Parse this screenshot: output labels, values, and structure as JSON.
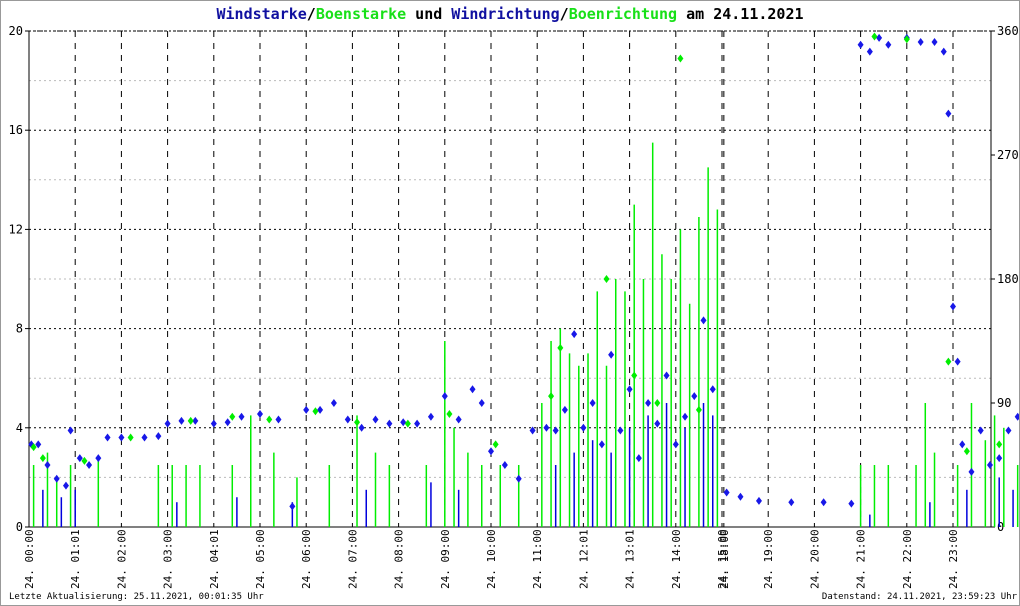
{
  "chart_data": {
    "type": "scatter",
    "title_parts": {
      "a": "Windstarke",
      "sep1": "/",
      "b": "Boenstarke",
      "mid": " und ",
      "c": "Windrichtung",
      "sep2": "/",
      "d": "Boenrichtung",
      "end": " am 24.11.2021"
    },
    "left_axis": {
      "ylim": [
        0,
        20
      ],
      "ticks": [
        0,
        4,
        8,
        12,
        16,
        20
      ]
    },
    "right_axis": {
      "ylim": [
        0,
        360
      ],
      "ticks": [
        0,
        90,
        180,
        270,
        360
      ]
    },
    "x_ticks": [
      {
        "u": 0,
        "label": "24. 00:00"
      },
      {
        "u": 1,
        "label": "24. 01:01"
      },
      {
        "u": 2,
        "label": "24. 02:00"
      },
      {
        "u": 3,
        "label": "24. 03:00"
      },
      {
        "u": 4,
        "label": "24. 04:01"
      },
      {
        "u": 5,
        "label": "24. 05:00"
      },
      {
        "u": 6,
        "label": "24. 06:00"
      },
      {
        "u": 7,
        "label": "24. 07:00"
      },
      {
        "u": 8,
        "label": "24. 08:00"
      },
      {
        "u": 9,
        "label": "24. 09:00"
      },
      {
        "u": 10,
        "label": "24. 10:00"
      },
      {
        "u": 11,
        "label": "24. 11:00"
      },
      {
        "u": 12,
        "label": "24. 12:01"
      },
      {
        "u": 13,
        "label": "24. 13:01"
      },
      {
        "u": 14,
        "label": "24. 14:00"
      },
      {
        "u": 15,
        "label": "24. 15:00"
      },
      {
        "u": 15.04,
        "label": "24. 18:00"
      },
      {
        "u": 16,
        "label": "24. 19:00"
      },
      {
        "u": 17,
        "label": "24. 20:00"
      },
      {
        "u": 18,
        "label": "24. 21:00"
      },
      {
        "u": 19,
        "label": "24. 22:00"
      },
      {
        "u": 20,
        "label": "24. 23:00"
      }
    ],
    "series": [
      {
        "name": "Boenstarke",
        "color": "#00ee00",
        "kind": "bars",
        "points": [
          [
            0.1,
            2.5
          ],
          [
            0.4,
            3
          ],
          [
            0.6,
            2
          ],
          [
            0.9,
            2.5
          ],
          [
            1.5,
            2.8
          ],
          [
            2.8,
            2.5
          ],
          [
            3.1,
            2.5
          ],
          [
            3.4,
            2.5
          ],
          [
            3.7,
            2.5
          ],
          [
            4.4,
            2.5
          ],
          [
            4.8,
            4.5
          ],
          [
            5.3,
            3
          ],
          [
            5.8,
            2
          ],
          [
            6.5,
            2.5
          ],
          [
            7.1,
            4.5
          ],
          [
            7.5,
            3
          ],
          [
            7.8,
            2.5
          ],
          [
            8.6,
            2.5
          ],
          [
            9,
            7.5
          ],
          [
            9.2,
            4
          ],
          [
            9.5,
            3
          ],
          [
            9.8,
            2.5
          ],
          [
            10.2,
            2.5
          ],
          [
            10.6,
            2.5
          ],
          [
            11.1,
            5
          ],
          [
            11.3,
            7.5
          ],
          [
            11.5,
            8
          ],
          [
            11.7,
            7
          ],
          [
            11.9,
            6.5
          ],
          [
            12.1,
            7
          ],
          [
            12.3,
            9.5
          ],
          [
            12.5,
            6.5
          ],
          [
            12.7,
            10
          ],
          [
            12.9,
            9.5
          ],
          [
            13.1,
            13
          ],
          [
            13.3,
            10
          ],
          [
            13.5,
            15.5
          ],
          [
            13.7,
            11
          ],
          [
            13.9,
            10
          ],
          [
            14.1,
            12
          ],
          [
            14.3,
            9
          ],
          [
            14.5,
            12.5
          ],
          [
            14.7,
            14.5
          ],
          [
            14.9,
            12.8
          ],
          [
            18,
            2.5
          ],
          [
            18.3,
            2.5
          ],
          [
            18.6,
            2.5
          ],
          [
            19.2,
            2.5
          ],
          [
            19.4,
            5
          ],
          [
            19.6,
            3
          ],
          [
            20.1,
            2.5
          ],
          [
            20.4,
            5
          ],
          [
            20.7,
            3.5
          ],
          [
            20.9,
            4.5
          ],
          [
            21.1,
            4
          ],
          [
            21.4,
            2.5
          ]
        ]
      },
      {
        "name": "Windstarke",
        "color": "#0000dd",
        "kind": "bars",
        "points": [
          [
            0.3,
            1.5
          ],
          [
            0.7,
            1.2
          ],
          [
            1,
            1.5
          ],
          [
            3.2,
            1
          ],
          [
            4.5,
            1.2
          ],
          [
            5.7,
            1
          ],
          [
            7.3,
            1.5
          ],
          [
            8.7,
            1.8
          ],
          [
            9.3,
            1.5
          ],
          [
            11.4,
            2.5
          ],
          [
            11.8,
            3
          ],
          [
            12.2,
            3.5
          ],
          [
            12.6,
            3
          ],
          [
            13,
            4
          ],
          [
            13.4,
            4.5
          ],
          [
            13.8,
            5
          ],
          [
            14.2,
            4
          ],
          [
            14.6,
            5
          ],
          [
            14.8,
            4.5
          ],
          [
            18.2,
            0.5
          ],
          [
            19.5,
            1
          ],
          [
            20.3,
            1.5
          ],
          [
            21,
            2
          ],
          [
            21.3,
            1.5
          ]
        ]
      },
      {
        "name": "Windrichtung",
        "color": "#1818e8",
        "kind": "diamonds",
        "points": [
          [
            0.05,
            60
          ],
          [
            0.2,
            60
          ],
          [
            0.4,
            45
          ],
          [
            0.6,
            35
          ],
          [
            0.8,
            30
          ],
          [
            0.9,
            70
          ],
          [
            1.1,
            50
          ],
          [
            1.3,
            45
          ],
          [
            1.5,
            50
          ],
          [
            1.7,
            65
          ],
          [
            2,
            65
          ],
          [
            2.5,
            65
          ],
          [
            2.8,
            66
          ],
          [
            3,
            75
          ],
          [
            3.3,
            77
          ],
          [
            3.6,
            77
          ],
          [
            4,
            75
          ],
          [
            4.3,
            76
          ],
          [
            4.6,
            80
          ],
          [
            5,
            82
          ],
          [
            5.4,
            78
          ],
          [
            5.7,
            15
          ],
          [
            6,
            85
          ],
          [
            6.3,
            85
          ],
          [
            6.6,
            90
          ],
          [
            6.9,
            78
          ],
          [
            7.2,
            72
          ],
          [
            7.5,
            78
          ],
          [
            7.8,
            75
          ],
          [
            8.1,
            76
          ],
          [
            8.4,
            75
          ],
          [
            8.7,
            80
          ],
          [
            9,
            95
          ],
          [
            9.3,
            78
          ],
          [
            9.6,
            100
          ],
          [
            9.8,
            90
          ],
          [
            10,
            55
          ],
          [
            10.3,
            45
          ],
          [
            10.6,
            35
          ],
          [
            10.9,
            70
          ],
          [
            11.2,
            72
          ],
          [
            11.4,
            70
          ],
          [
            11.6,
            85
          ],
          [
            11.8,
            140
          ],
          [
            12,
            72
          ],
          [
            12.2,
            90
          ],
          [
            12.4,
            60
          ],
          [
            12.6,
            125
          ],
          [
            12.8,
            70
          ],
          [
            13,
            100
          ],
          [
            13.2,
            50
          ],
          [
            13.4,
            90
          ],
          [
            13.6,
            75
          ],
          [
            13.8,
            110
          ],
          [
            14,
            60
          ],
          [
            14.2,
            80
          ],
          [
            14.4,
            95
          ],
          [
            14.6,
            150
          ],
          [
            14.8,
            100
          ],
          [
            15.1,
            25
          ],
          [
            15.4,
            22
          ],
          [
            15.8,
            19
          ],
          [
            16.5,
            18
          ],
          [
            17.2,
            18
          ],
          [
            17.8,
            17
          ],
          [
            18,
            350
          ],
          [
            18.2,
            345
          ],
          [
            18.4,
            355
          ],
          [
            18.6,
            350
          ],
          [
            19,
            355
          ],
          [
            19.3,
            352
          ],
          [
            19.6,
            352
          ],
          [
            19.8,
            345
          ],
          [
            19.9,
            300
          ],
          [
            20,
            160
          ],
          [
            20.1,
            120
          ],
          [
            20.2,
            60
          ],
          [
            20.4,
            40
          ],
          [
            20.6,
            70
          ],
          [
            20.8,
            45
          ],
          [
            21,
            50
          ],
          [
            21.2,
            70
          ],
          [
            21.4,
            80
          ]
        ]
      },
      {
        "name": "Boenrichtung",
        "color": "#00ee00",
        "kind": "diamonds",
        "points": [
          [
            0.1,
            58
          ],
          [
            0.3,
            50
          ],
          [
            1.2,
            48
          ],
          [
            2.2,
            65
          ],
          [
            3.5,
            77
          ],
          [
            4.4,
            80
          ],
          [
            5.2,
            78
          ],
          [
            6.2,
            84
          ],
          [
            7.1,
            76
          ],
          [
            8.2,
            75
          ],
          [
            9.1,
            82
          ],
          [
            10.1,
            60
          ],
          [
            11.3,
            95
          ],
          [
            11.5,
            130
          ],
          [
            12.5,
            180
          ],
          [
            13.1,
            110
          ],
          [
            13.6,
            90
          ],
          [
            14.1,
            340
          ],
          [
            14.5,
            85
          ],
          [
            18.3,
            356
          ],
          [
            19,
            354
          ],
          [
            19.9,
            120
          ],
          [
            20.3,
            55
          ],
          [
            21,
            60
          ]
        ]
      }
    ]
  },
  "footer": {
    "left": "Letzte Aktualisierung: 25.11.2021, 00:01:35 Uhr",
    "right": "Datenstand: 24.11.2021, 23:59:23 Uhr"
  }
}
